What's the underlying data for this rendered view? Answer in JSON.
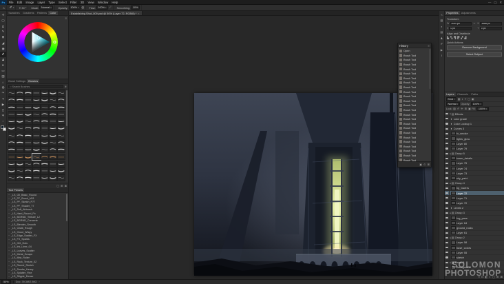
{
  "colors": {
    "panel_bg": "#323232",
    "canvas_bg": "#282828",
    "accent_blue": "#31a8ff",
    "selected_layer_bg": "#4e616f",
    "glow_green": "#d8e48e"
  },
  "window": {
    "controls": [
      {
        "name": "minimize-button",
        "glyph": "—"
      },
      {
        "name": "maximize-button",
        "glyph": "▢"
      },
      {
        "name": "close-button",
        "glyph": "✕"
      }
    ]
  },
  "menu_bar": {
    "logo": "Ps",
    "items": [
      "File",
      "Edit",
      "Image",
      "Layer",
      "Type",
      "Select",
      "Filter",
      "3D",
      "View",
      "Window",
      "Help"
    ]
  },
  "options_bar": {
    "brush_size": "30",
    "mode_label": "Mode:",
    "mode_value": "Normal",
    "opacity_label": "Opacity:",
    "opacity_value": "100%",
    "flow_label": "Flow:",
    "flow_value": "100%",
    "smoothing_label": "Smoothing:",
    "smoothing_value": "10%"
  },
  "toolbar": {
    "tools": [
      {
        "name": "move",
        "glyph": "✛"
      },
      {
        "name": "marquee",
        "glyph": "▢"
      },
      {
        "name": "lasso",
        "glyph": "Ω"
      },
      {
        "name": "quick-selection",
        "glyph": "✎"
      },
      {
        "name": "crop",
        "glyph": "⊞"
      },
      {
        "name": "eyedropper",
        "glyph": "◢"
      },
      {
        "name": "spot-healing",
        "glyph": "◉"
      },
      {
        "name": "brush",
        "glyph": "✐",
        "active": true
      },
      {
        "name": "clone-stamp",
        "glyph": "♟"
      },
      {
        "name": "history-brush",
        "glyph": "✒"
      },
      {
        "name": "eraser",
        "glyph": "▭"
      },
      {
        "name": "gradient",
        "glyph": "▥"
      },
      {
        "name": "blur",
        "glyph": "○"
      },
      {
        "name": "dodge",
        "glyph": "◍"
      },
      {
        "name": "pen",
        "glyph": "✑"
      },
      {
        "name": "type",
        "glyph": "T"
      },
      {
        "name": "path-selection",
        "glyph": "▶"
      },
      {
        "name": "shape",
        "glyph": "◻"
      },
      {
        "name": "hand",
        "glyph": "Ψ"
      },
      {
        "name": "zoom",
        "glyph": "◌"
      }
    ]
  },
  "left_panels": {
    "color_tabs": [
      {
        "label": "Swatches"
      },
      {
        "label": "Gradients"
      },
      {
        "label": "Patterns"
      },
      {
        "label": "Color",
        "active": true
      }
    ],
    "brush_tabs": [
      {
        "label": "Brush Settings"
      },
      {
        "label": "Brushes",
        "active": true
      }
    ],
    "brush_search_placeholder": "Search Brushes",
    "brush_grid": {
      "count": 91,
      "selected": 66,
      "warm_start": 63,
      "warm_end": 69
    },
    "brush_footer_icons": [
      {
        "name": "new-brush-group-icon",
        "glyph": "▢"
      },
      {
        "name": "new-brush-icon",
        "glyph": "⊞"
      },
      {
        "name": "delete-brush-icon",
        "glyph": "⊠"
      }
    ],
    "tool_presets_title": "Tool Presets",
    "tool_presets": [
      "_LS_Oil_Basic_Round",
      "_LS_PF_Brush_M11",
      "_LS_PF_Sketch_P77",
      "_LS_PF_Shader_T7",
      "_LS_Soft_Airbrush",
      "_LS_Hard_Round_Px",
      "_LS_BGRND_Texture_L2",
      "_LS_BGRND_Concrete",
      "_LS_Blender_Smooth",
      "_LS_Chalk_Rough",
      "_LS_Cloud_Wispy",
      "_LS_Edge_Scatter_FX",
      "_LS_FX_Sparks",
      "_LS_Grit_Dots",
      "_LS_Ink_Liner_04",
      "_LS_Leaves_Scatter",
      "_LS_Metal_Scrape",
      "_LS_Mist_Roller",
      "_LS_Rock_Texture_02",
      "_LS_Round_Sketch",
      "_LS_Smoke_Heavy",
      "_LS_Splatter_Fine",
      "_LS_Stipple_Dense"
    ]
  },
  "document_tab": {
    "title": "Establishing Shot_009.psd @ 50% (Layer 72, RGB/8) *",
    "close": "×"
  },
  "history_panel": {
    "title": "History",
    "items": [
      "Open",
      "Brush Tool",
      "Brush Tool",
      "Brush Tool",
      "Brush Tool",
      "Brush Tool",
      "Brush Tool",
      "Brush Tool",
      "Brush Tool",
      "Brush Tool",
      "Brush Tool",
      "Brush Tool",
      "Brush Tool",
      "Brush Tool",
      "Brush Tool",
      "Brush Tool",
      "Brush Tool",
      "Brush Tool",
      "Brush Tool",
      "Brush Tool",
      "Brush Tool",
      "Brush Tool",
      "Brush Tool",
      "Brush Tool",
      "Brush Tool"
    ],
    "footer_icons": [
      {
        "name": "new-document-from-state-icon",
        "glyph": "▣"
      },
      {
        "name": "new-snapshot-icon",
        "glyph": "⊙"
      },
      {
        "name": "delete-state-icon",
        "glyph": "⊠"
      }
    ]
  },
  "right_rail": [
    {
      "name": "collapse-panels-icon",
      "glyph": "«"
    },
    {
      "name": "color-panel-icon",
      "glyph": "▧"
    },
    {
      "name": "adjustments-panel-icon",
      "glyph": "◐"
    },
    {
      "name": "libraries-panel-icon",
      "glyph": "▤"
    },
    {
      "name": "clone-source-panel-icon",
      "glyph": "♟"
    },
    {
      "name": "brush-settings-panel-icon",
      "glyph": "✐"
    },
    {
      "name": "timeline-panel-icon",
      "glyph": "▶"
    },
    {
      "name": "info-panel-icon",
      "glyph": "i"
    }
  ],
  "properties": {
    "tabs": [
      {
        "label": "Properties",
        "active": true
      },
      {
        "label": "Adjustments"
      }
    ],
    "section_transform": "Transform",
    "w_label": "W",
    "w_value": "3000 px",
    "h_label": "H",
    "h_value": "1688 px",
    "x_label": "X",
    "x_value": "0 px",
    "y_label": "Y",
    "y_value": "0 px",
    "section_align": "Align and Distribute",
    "align_icons": [
      {
        "name": "align-left-icon",
        "glyph": "▙"
      },
      {
        "name": "align-center-h-icon",
        "glyph": "▚"
      },
      {
        "name": "align-right-icon",
        "glyph": "▜"
      },
      {
        "name": "align-top-icon",
        "glyph": "▛"
      },
      {
        "name": "align-middle-icon",
        "glyph": "▞"
      },
      {
        "name": "align-bottom-icon",
        "glyph": "▟"
      }
    ],
    "section_quick": "Quick Actions",
    "quick_buttons": [
      "Remove Background",
      "Select Subject"
    ]
  },
  "layers_panel": {
    "tabs": [
      {
        "label": "Layers",
        "active": true
      },
      {
        "label": "Channels"
      },
      {
        "label": "Paths"
      }
    ],
    "filter_label": "Kind",
    "filter_icons": [
      {
        "name": "filter-pixel-icon",
        "glyph": "▦"
      },
      {
        "name": "filter-adjustment-icon",
        "glyph": "◐"
      },
      {
        "name": "filter-type-icon",
        "glyph": "T"
      },
      {
        "name": "filter-shape-icon",
        "glyph": "◻"
      },
      {
        "name": "filter-smart-object-icon",
        "glyph": "▣"
      }
    ],
    "blend_mode": "Normal",
    "opacity_label": "Opacity:",
    "opacity_value": "100%",
    "lock_label": "Lock:",
    "lock_icons": [
      {
        "name": "lock-transparency-icon",
        "glyph": "▨"
      },
      {
        "name": "lock-paint-icon",
        "glyph": "✐"
      },
      {
        "name": "lock-position-icon",
        "glyph": "✛"
      },
      {
        "name": "lock-artboard-icon",
        "glyph": "⊞"
      },
      {
        "name": "lock-all-icon",
        "glyph": "▣"
      }
    ],
    "fill_label": "Fill:",
    "fill_value": "100%",
    "layers": [
      {
        "name": "Effects",
        "type": "group"
      },
      {
        "name": "color grade",
        "type": "adj"
      },
      {
        "name": "Color Lookup 1",
        "type": "adj"
      },
      {
        "name": "Curves 3",
        "type": "adj"
      },
      {
        "name": "fx_smoke",
        "type": "layer"
      },
      {
        "name": "lights_glow",
        "type": "layer"
      },
      {
        "name": "Layer 80",
        "type": "layer"
      },
      {
        "name": "Layer 79",
        "type": "layer"
      },
      {
        "name": "Group 5",
        "type": "group"
      },
      {
        "name": "tower_details",
        "type": "layer"
      },
      {
        "name": "Layer 75",
        "type": "layer"
      },
      {
        "name": "Layer 74",
        "type": "layer"
      },
      {
        "name": "Layer 73",
        "type": "layer"
      },
      {
        "name": "sky_paint",
        "type": "layer"
      },
      {
        "name": "Group 4",
        "type": "group"
      },
      {
        "name": "bg_towers",
        "type": "layer"
      },
      {
        "name": "Layer 72",
        "type": "layer",
        "selected": true
      },
      {
        "name": "Layer 71",
        "type": "layer"
      },
      {
        "name": "Layer 70",
        "type": "layer"
      },
      {
        "name": "Levels 2",
        "type": "adj"
      },
      {
        "name": "Group 3",
        "type": "group"
      },
      {
        "name": "fog_pass",
        "type": "layer"
      },
      {
        "name": "Layer 64",
        "type": "layer"
      },
      {
        "name": "ground_rocks",
        "type": "layer"
      },
      {
        "name": "Layer 61",
        "type": "layer"
      },
      {
        "name": "Group 2",
        "type": "group"
      },
      {
        "name": "Layer 58",
        "type": "layer"
      },
      {
        "name": "base_colors",
        "type": "layer"
      },
      {
        "name": "Layer 55",
        "type": "layer"
      },
      {
        "name": "sketch",
        "type": "layer"
      },
      {
        "name": "Group 1",
        "type": "group"
      },
      {
        "name": "Background",
        "type": "layer"
      }
    ],
    "footer_icons": [
      {
        "name": "link-layers-icon",
        "glyph": "∞"
      },
      {
        "name": "layer-style-icon",
        "glyph": "fx"
      },
      {
        "name": "layer-mask-icon",
        "glyph": "◧"
      },
      {
        "name": "adjustment-layer-icon",
        "glyph": "◐"
      },
      {
        "name": "new-group-icon",
        "glyph": "▢"
      },
      {
        "name": "new-layer-icon",
        "glyph": "⊞"
      },
      {
        "name": "delete-layer-icon",
        "glyph": "⊠"
      }
    ]
  },
  "status_bar": {
    "zoom": "50%",
    "doc_info": "Doc: 39.3M/2.98G",
    "expand": "›"
  },
  "watermark": {
    "line1": "SOLOMON",
    "line2": "PHOTOSHOP"
  }
}
